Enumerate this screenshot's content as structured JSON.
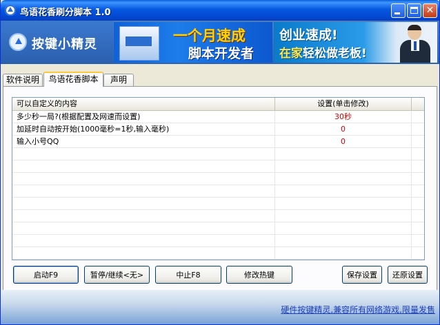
{
  "window": {
    "title": "鸟语花香刷分脚本 1.0",
    "minimize": "",
    "maximize": "",
    "close": "✕"
  },
  "banner": {
    "logo_text": "按键小精灵",
    "ad1_line1": "一个月速成",
    "ad1_line2": "脚本开发者",
    "ad2_line1": "创业速成!",
    "ad2_line2_a": "在家",
    "ad2_line2_b": "轻松做老板!"
  },
  "tabs": [
    {
      "label": "软件说明"
    },
    {
      "label": "鸟语花香脚本"
    },
    {
      "label": "声明"
    }
  ],
  "table": {
    "headers": [
      "可以自定义的内容",
      "设置(单击修改)"
    ],
    "rows": [
      {
        "label": "多少秒一局?(根据配置及网速而设置)",
        "value": "30秒"
      },
      {
        "label": "加延时自动按开始(1000毫秒=1秒,输入毫秒)",
        "value": "0"
      },
      {
        "label": "输入小号QQ",
        "value": "0"
      }
    ]
  },
  "buttons": {
    "start": "启动F9",
    "pause": "暂停/继续<无>",
    "stop": "中止F8",
    "hotkey": "修改热键",
    "save": "保存设置",
    "restore": "还原设置"
  },
  "status": {
    "link": "硬件按键精灵,兼容所有网络游戏,限量发售"
  },
  "colors": {
    "titlebar": "#0758e0",
    "value_text": "#d40000",
    "link": "#1c3fb8",
    "tab_highlight": "#ffc73c"
  }
}
